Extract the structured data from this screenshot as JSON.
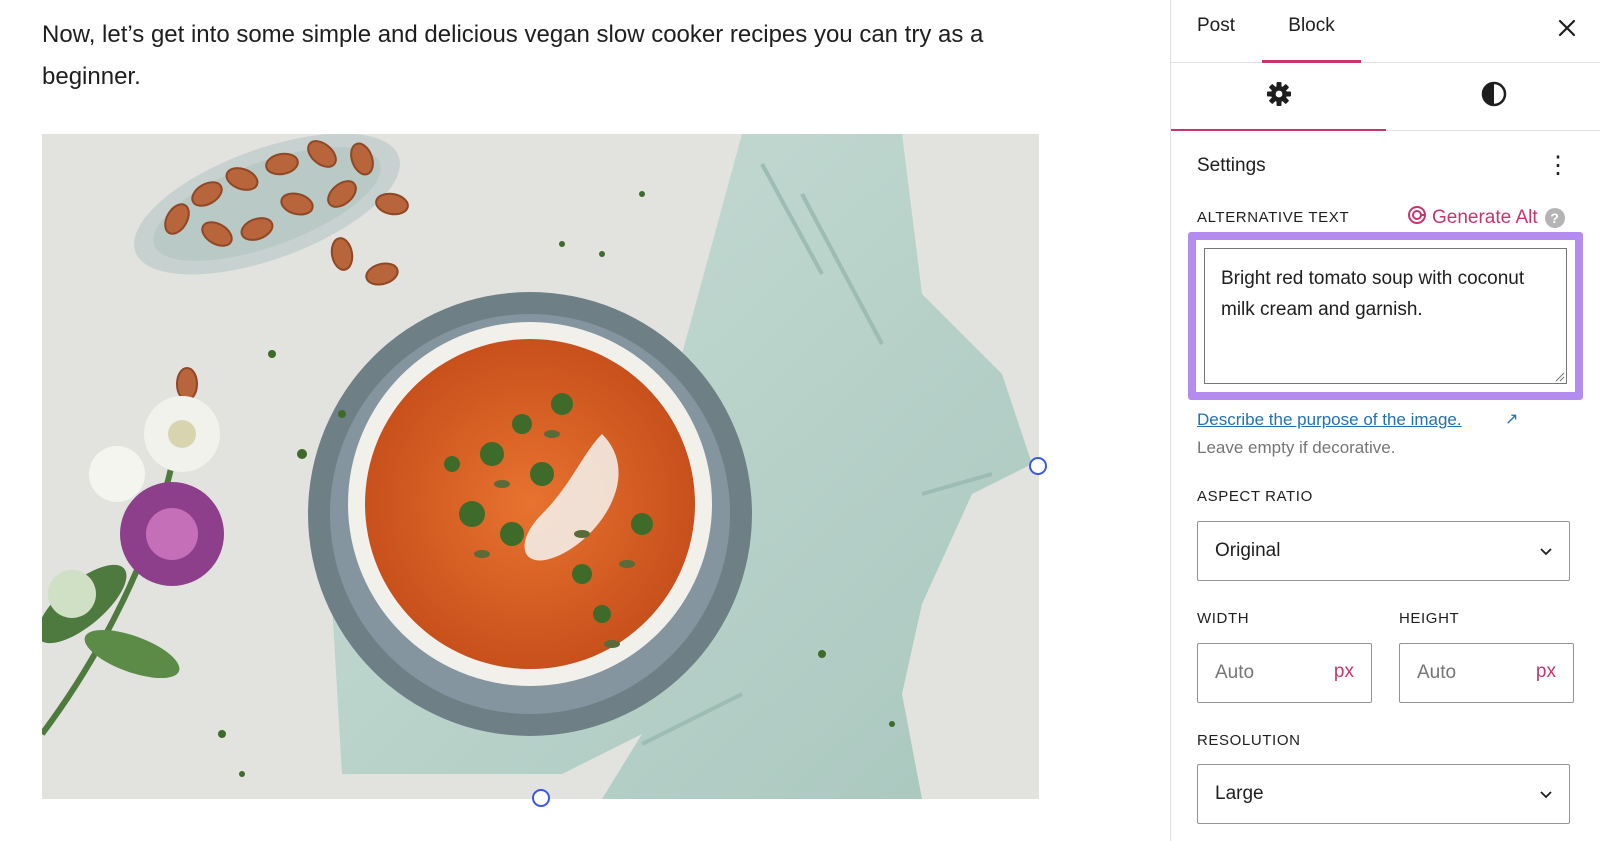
{
  "editor": {
    "intro_text": "Now, let’s get into some simple and delicious vegan slow cooker recipes you can try as a beginner."
  },
  "sidebar": {
    "tabs": [
      {
        "label": "Post",
        "active": false
      },
      {
        "label": "Block",
        "active": true
      }
    ],
    "subtabs": [
      {
        "icon": "gear-icon",
        "active": true
      },
      {
        "icon": "contrast-icon",
        "active": false
      }
    ],
    "section_title": "Settings",
    "alt_text": {
      "label": "ALTERNATIVE TEXT",
      "generate_label": "Generate Alt",
      "value": "Bright red tomato soup with coconut milk cream and garnish.",
      "describe_link": "Describe the purpose of the image.",
      "help": "Leave empty if decorative."
    },
    "aspect_ratio": {
      "label": "ASPECT RATIO",
      "value": "Original"
    },
    "width": {
      "label": "WIDTH",
      "placeholder": "Auto",
      "unit": "px"
    },
    "height": {
      "label": "HEIGHT",
      "placeholder": "Auto",
      "unit": "px"
    },
    "resolution": {
      "label": "RESOLUTION",
      "value": "Large"
    }
  },
  "colors": {
    "accent": "#c8356d",
    "link": "#2271b1",
    "highlight_frame": "#b48cf0",
    "handle": "#3858e9"
  }
}
